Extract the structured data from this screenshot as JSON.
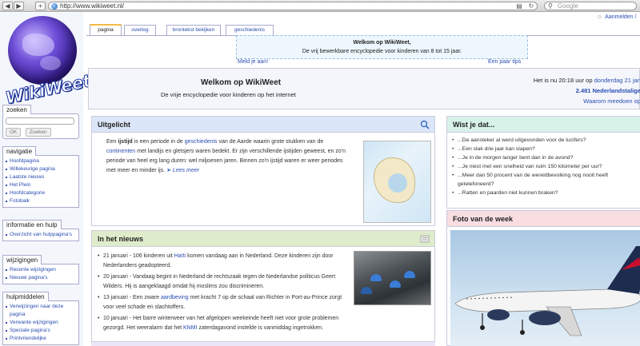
{
  "browser": {
    "url": "http://www.wikiweet.nl/",
    "search_placeholder": "Google",
    "back": "◀",
    "forward": "▶",
    "add": "+"
  },
  "user_links": "Aanmelden /",
  "logo_text": "WikiWeet",
  "sidebar": {
    "search": {
      "title": "zoeken",
      "ok": "OK",
      "zoeken": "Zoeken"
    },
    "navigatie": {
      "title": "navigatie",
      "items": [
        "Hoofdpagina",
        "Willekeurige pagina",
        "Laatste nieuws",
        "Het Plein",
        "Hoofdcategorie",
        "Fotobalk"
      ]
    },
    "informatie": {
      "title": "informatie en hulp",
      "items": [
        "Overzicht van hulppagina's"
      ]
    },
    "wijzigingen": {
      "title": "wijzigingen",
      "items": [
        "Recente wijzigingen",
        "Nieuwe pagina's"
      ]
    },
    "hulpmiddelen": {
      "title": "hulpmiddelen",
      "items": [
        "Verwijzingen naar deze pagina",
        "Verwante wijzigingen",
        "Speciale pagina's",
        "Printvriendelijke"
      ]
    }
  },
  "tabs": [
    "pagina",
    "overleg",
    "brontekst bekijken",
    "geschiedenis"
  ],
  "notice": {
    "title": "Welkom op WikiWeet,",
    "text": "De vrij bewerkbare encyclopedie voor kinderen van 8 tot 15 jaar.",
    "left_link": "Meld je aan!",
    "right_link": "Een paar tips"
  },
  "welcome": {
    "title": "Welkom op WikiWeet",
    "subtitle": "De vrije encyclopedie voor kinderen op het internet",
    "time_prefix": "Het is nu 20:18 uur op",
    "date_link": "donderdag 21 jan",
    "count": "2.481",
    "count_label": "Nederlandstalige",
    "help_link": "Waarom meedoen op"
  },
  "uitgelicht": {
    "title": "Uitgelicht",
    "t1": "Een ",
    "t1_bold": "ijstijd",
    "t2": " is een periode in de ",
    "t2_link": "geschiedenis",
    "t3": " van de Aarde waarin grote stukken van de ",
    "t3_link": "continenten",
    "t4": " met landijs en gletsjers waren bedekt. Er zijn verschillende ijstijden geweest, en zo'n periode van heel erg lang duren: wel miljoenen jaren. Binnen zo'n ijstijd waren er weer periodes met meer en minder ijs.",
    "more": "Lees meer"
  },
  "nieuws": {
    "title": "In het nieuws",
    "items": [
      {
        "a": "21 januari - 106 kinderen uit ",
        "link": "Haïti",
        "b": " komen vandaag aan in Nederland. Deze kinderen zijn door Nederlanders geadopteerd."
      },
      {
        "a": "20 januari - Vandaag begint in Nederland de rechtszaak tegen de Nederlandse politicus Geert Wilders. Hij is aangeklaagd omdat hij moslims zou discrimineren.",
        "link": "",
        "b": ""
      },
      {
        "a": "13 januari - Een zware ",
        "link": "aardbeving",
        "b": " met kracht 7 op de schaal van Richter in Port-au-Prince zorgt voor veel schade en slachtoffers."
      },
      {
        "a": "10 januari - Het barre winterweer van het afgelopen weekeinde heeft niet voor grote problemen gezorgd. Het weeralarm dat het ",
        "link": "KNMI",
        "b": " zaterdagavond instelde is vanmiddag ingetrokken."
      }
    ]
  },
  "wistje": {
    "title": "Wist je dat...",
    "items": [
      "...De aansteker al werd uitgevonden voor de lucifers?",
      "...Een slak drie jaar kan slapen?",
      "...Je in de morgen langer bent dan in de avond?",
      "...Je niest met een snelheid van ruim 150 kilometer per uur?",
      "...Meer dan 50 procent van de wereldbevolking nog nooit heeft getelefoneerd?",
      "...Ratten en paarden niet kunnen braken?"
    ]
  },
  "foto": {
    "title": "Foto van de week"
  },
  "colors": {
    "link": "#2a4db3",
    "tab_accent": "#f4b942"
  }
}
